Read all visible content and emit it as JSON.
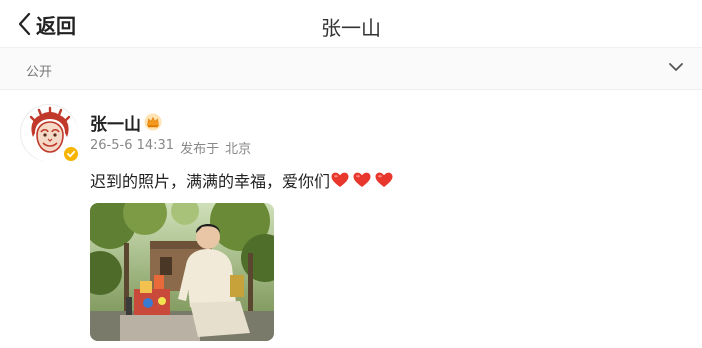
{
  "topbar": {
    "back_label": "返回",
    "back_icon": "chevron-left-icon",
    "title": "张一山"
  },
  "visibility": {
    "label": "公开",
    "icon": "chevron-down-icon"
  },
  "post": {
    "author": {
      "name": "张一山",
      "badge_icon": "crown-icon",
      "verified_icon": "verified-badge-icon",
      "avatar_icon": "monkey-king-avatar"
    },
    "date": "26-5-6 14:31",
    "location_prefix": "发布于",
    "location": "北京",
    "text": "迟到的照片，满满的幸福，爱你们",
    "emoji": [
      "heart-icon",
      "heart-icon",
      "heart-icon"
    ],
    "image_icon": "photo-thumbnail"
  },
  "colors": {
    "accent_red": "#e8372c",
    "verified_gold": "#f7b500",
    "meta_gray": "#888888"
  }
}
